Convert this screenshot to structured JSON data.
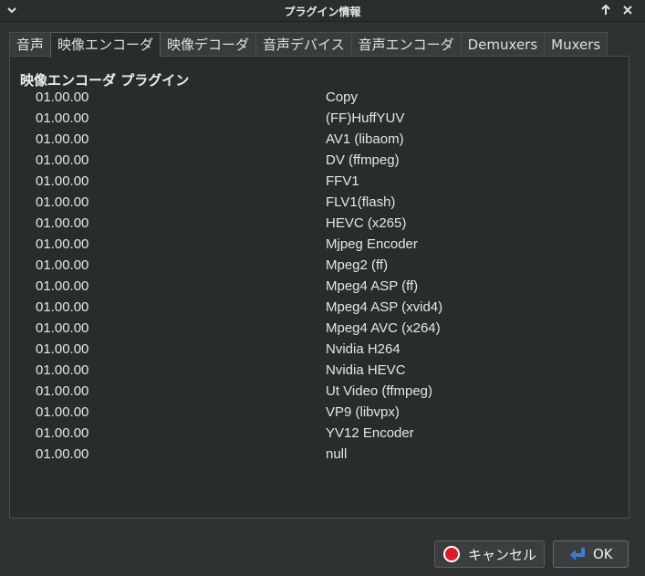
{
  "window": {
    "title": "プラグイン情報"
  },
  "tabs": [
    {
      "label": "音声"
    },
    {
      "label": "映像エンコーダ"
    },
    {
      "label": "映像デコーダ"
    },
    {
      "label": "音声デバイス"
    },
    {
      "label": "音声エンコーダ"
    },
    {
      "label": "Demuxers"
    },
    {
      "label": "Muxers"
    }
  ],
  "active_tab": 1,
  "section": {
    "title": "映像エンコーダ プラグイン"
  },
  "plugins": [
    {
      "version": "01.00.00",
      "name": "Copy"
    },
    {
      "version": "01.00.00",
      "name": "(FF)HuffYUV"
    },
    {
      "version": "01.00.00",
      "name": "AV1 (libaom)"
    },
    {
      "version": "01.00.00",
      "name": "DV (ffmpeg)"
    },
    {
      "version": "01.00.00",
      "name": "FFV1"
    },
    {
      "version": "01.00.00",
      "name": "FLV1(flash)"
    },
    {
      "version": "01.00.00",
      "name": "HEVC (x265)"
    },
    {
      "version": "01.00.00",
      "name": "Mjpeg Encoder"
    },
    {
      "version": "01.00.00",
      "name": "Mpeg2 (ff)"
    },
    {
      "version": "01.00.00",
      "name": "Mpeg4 ASP (ff)"
    },
    {
      "version": "01.00.00",
      "name": "Mpeg4 ASP (xvid4)"
    },
    {
      "version": "01.00.00",
      "name": "Mpeg4 AVC (x264)"
    },
    {
      "version": "01.00.00",
      "name": "Nvidia H264"
    },
    {
      "version": "01.00.00",
      "name": "Nvidia HEVC"
    },
    {
      "version": "01.00.00",
      "name": "Ut Video (ffmpeg)"
    },
    {
      "version": "01.00.00",
      "name": "VP9 (libvpx)"
    },
    {
      "version": "01.00.00",
      "name": "YV12 Encoder"
    },
    {
      "version": "01.00.00",
      "name": "null"
    }
  ],
  "buttons": {
    "cancel_label": "キャンセル",
    "ok_label": "OK"
  },
  "icons": {
    "menu": "chevron-down-icon",
    "maximize": "arrow-up-icon",
    "close": "close-icon",
    "cancel": "stop-circle-icon",
    "ok": "return-arrow-icon"
  },
  "colors": {
    "stop_red": "#e01b24",
    "ok_blue": "#3a7bd5"
  }
}
